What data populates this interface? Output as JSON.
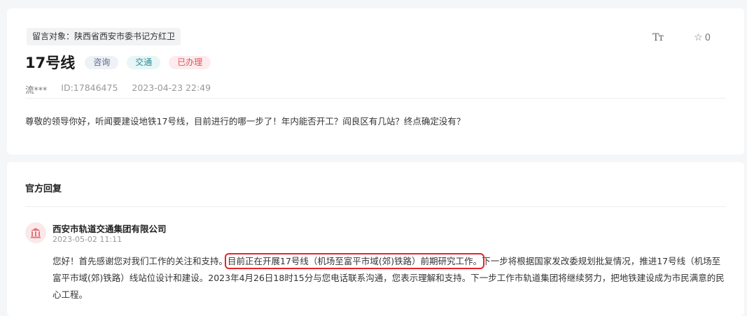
{
  "question": {
    "target_label": "留言对象：陕西省西安市委书记方红卫",
    "title": "17号线",
    "tags": [
      "咨询",
      "交通",
      "已办理"
    ],
    "user": "流***",
    "id": "ID:17846475",
    "time": "2023-04-23 22:49",
    "body": "尊敬的领导你好，听闻要建设地铁17号线，目前进行的哪一步了！年内能否开工？阎良区有几站？终点确定没有？",
    "font_icon": "Tт",
    "star_count": "0"
  },
  "reply": {
    "heading": "官方回复",
    "org": "西安市轨道交通集团有限公司",
    "time": "2023-05-02 11:11",
    "body_before": "您好！首先感谢您对我们工作的关注和支持。",
    "body_highlight": "目前正在开展17号线（机场至富平市域(郊)铁路）前期研究工作。",
    "body_after": "下一步将根据国家发改委规划批复情况，推进17号线（机场至富平市域(郊)铁路）线站位设计和建设。2023年4月26日18时15分与您电话联系沟通，您表示理解和支持。下一步工作市轨道集团将继续努力，把地铁建设成为市民满意的民心工程。"
  },
  "colors": {
    "highlight_border": "#e0262a",
    "tag_done": "#e0505f",
    "tag_traffic": "#2b8c95"
  }
}
